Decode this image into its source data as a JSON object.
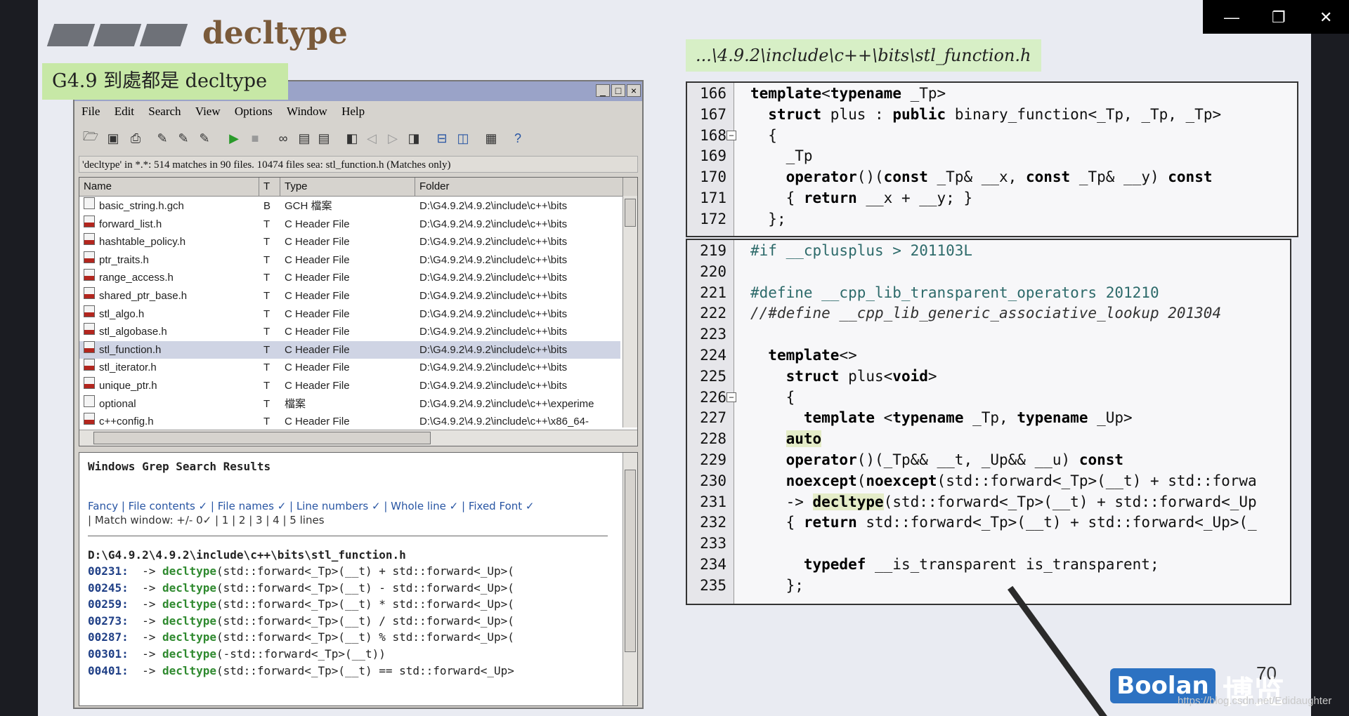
{
  "slide": {
    "title": "decltype",
    "green_label": "G4.9 到處都是 decltype",
    "path_label": "...\\4.9.2\\include\\c++\\bits\\stl_function.h",
    "page_number": "70"
  },
  "grep_window": {
    "menu": [
      "File",
      "Edit",
      "Search",
      "View",
      "Options",
      "Window",
      "Help"
    ],
    "status": "'decltype' in *.*: 514 matches in 90 files. 10474 files sea: stl_function.h (Matches only)",
    "columns": [
      "Name",
      "T",
      "Type",
      "Folder"
    ],
    "files": [
      {
        "name": "basic_string.h.gch",
        "t": "B",
        "type": "GCH 檔案",
        "folder": "D:\\G4.9.2\\4.9.2\\include\\c++\\bits"
      },
      {
        "name": "forward_list.h",
        "t": "T",
        "type": "C Header File",
        "folder": "D:\\G4.9.2\\4.9.2\\include\\c++\\bits"
      },
      {
        "name": "hashtable_policy.h",
        "t": "T",
        "type": "C Header File",
        "folder": "D:\\G4.9.2\\4.9.2\\include\\c++\\bits"
      },
      {
        "name": "ptr_traits.h",
        "t": "T",
        "type": "C Header File",
        "folder": "D:\\G4.9.2\\4.9.2\\include\\c++\\bits"
      },
      {
        "name": "range_access.h",
        "t": "T",
        "type": "C Header File",
        "folder": "D:\\G4.9.2\\4.9.2\\include\\c++\\bits"
      },
      {
        "name": "shared_ptr_base.h",
        "t": "T",
        "type": "C Header File",
        "folder": "D:\\G4.9.2\\4.9.2\\include\\c++\\bits"
      },
      {
        "name": "stl_algo.h",
        "t": "T",
        "type": "C Header File",
        "folder": "D:\\G4.9.2\\4.9.2\\include\\c++\\bits"
      },
      {
        "name": "stl_algobase.h",
        "t": "T",
        "type": "C Header File",
        "folder": "D:\\G4.9.2\\4.9.2\\include\\c++\\bits"
      },
      {
        "name": "stl_function.h",
        "t": "T",
        "type": "C Header File",
        "folder": "D:\\G4.9.2\\4.9.2\\include\\c++\\bits"
      },
      {
        "name": "stl_iterator.h",
        "t": "T",
        "type": "C Header File",
        "folder": "D:\\G4.9.2\\4.9.2\\include\\c++\\bits"
      },
      {
        "name": "unique_ptr.h",
        "t": "T",
        "type": "C Header File",
        "folder": "D:\\G4.9.2\\4.9.2\\include\\c++\\bits"
      },
      {
        "name": "optional",
        "t": "T",
        "type": "檔案",
        "folder": "D:\\G4.9.2\\4.9.2\\include\\c++\\experime"
      },
      {
        "name": "c++config.h",
        "t": "T",
        "type": "C Header File",
        "folder": "D:\\G4.9.2\\4.9.2\\include\\c++\\x86_64-"
      }
    ],
    "results_title": "Windows Grep Search Results",
    "results_links_1": "Fancy | File contents ✓ | File names ✓ | Line numbers ✓ | Whole line ✓ | Fixed Font ✓",
    "results_links_2": "| Match window: +/- 0✓ | 1 | 2 | 3 | 4 | 5 lines",
    "results_file": "D:\\G4.9.2\\4.9.2\\include\\c++\\bits\\stl_function.h",
    "results": [
      {
        "num": "00231:",
        "pre": "  -> ",
        "kw": "decltype",
        "rest": "(std::forward<_Tp>(__t) + std::forward<_Up>("
      },
      {
        "num": "00245:",
        "pre": "  -> ",
        "kw": "decltype",
        "rest": "(std::forward<_Tp>(__t) - std::forward<_Up>("
      },
      {
        "num": "00259:",
        "pre": "  -> ",
        "kw": "decltype",
        "rest": "(std::forward<_Tp>(__t) * std::forward<_Up>("
      },
      {
        "num": "00273:",
        "pre": "  -> ",
        "kw": "decltype",
        "rest": "(std::forward<_Tp>(__t) / std::forward<_Up>("
      },
      {
        "num": "00287:",
        "pre": "  -> ",
        "kw": "decltype",
        "rest": "(std::forward<_Tp>(__t) % std::forward<_Up>("
      },
      {
        "num": "00301:",
        "pre": "  -> ",
        "kw": "decltype",
        "rest": "(-std::forward<_Tp>(__t))"
      },
      {
        "num": "00401:",
        "pre": "  -> ",
        "kw": "decltype",
        "rest": "(std::forward<_Tp>(__t) == std::forward<_Up>"
      }
    ]
  },
  "code_top": [
    {
      "ln": "166",
      "indent": "",
      "parts": [
        [
          "kwb",
          "template"
        ],
        [
          "",
          "<"
        ],
        [
          "kwb",
          "typename"
        ],
        [
          "",
          " _Tp>"
        ]
      ]
    },
    {
      "ln": "167",
      "indent": "  ",
      "parts": [
        [
          "kwb",
          "struct"
        ],
        [
          "",
          " plus : "
        ],
        [
          "kwb",
          "public"
        ],
        [
          "",
          " binary_function<_Tp, _Tp, _Tp>"
        ]
      ]
    },
    {
      "ln": "168",
      "indent": "  ",
      "parts": [
        [
          "",
          "{"
        ]
      ]
    },
    {
      "ln": "169",
      "indent": "    ",
      "parts": [
        [
          "",
          "_Tp"
        ]
      ]
    },
    {
      "ln": "170",
      "indent": "    ",
      "parts": [
        [
          "kwb",
          "operator"
        ],
        [
          "",
          "()("
        ],
        [
          "kwb",
          "const"
        ],
        [
          "",
          " _Tp& __x, "
        ],
        [
          "kwb",
          "const"
        ],
        [
          "",
          " _Tp& __y) "
        ],
        [
          "kwb",
          "const"
        ]
      ]
    },
    {
      "ln": "171",
      "indent": "    ",
      "parts": [
        [
          "",
          "{ "
        ],
        [
          "kwb",
          "return"
        ],
        [
          "",
          " __x + __y; }"
        ]
      ]
    },
    {
      "ln": "172",
      "indent": "  ",
      "parts": [
        [
          "",
          "};"
        ]
      ]
    }
  ],
  "code_bottom": [
    {
      "ln": "219",
      "indent": "",
      "parts": [
        [
          "pp",
          "#if __cplusplus > 201103L"
        ]
      ]
    },
    {
      "ln": "220",
      "indent": "",
      "parts": []
    },
    {
      "ln": "221",
      "indent": "",
      "parts": [
        [
          "pp",
          "#define __cpp_lib_transparent_operators 201210"
        ]
      ]
    },
    {
      "ln": "222",
      "indent": "",
      "parts": [
        [
          "cm",
          "//#define __cpp_lib_generic_associative_lookup 201304"
        ]
      ]
    },
    {
      "ln": "223",
      "indent": "",
      "parts": []
    },
    {
      "ln": "224",
      "indent": "  ",
      "parts": [
        [
          "kwb",
          "template"
        ],
        [
          "",
          "<>"
        ]
      ]
    },
    {
      "ln": "225",
      "indent": "    ",
      "parts": [
        [
          "kwb",
          "struct"
        ],
        [
          "",
          " plus<"
        ],
        [
          "kwb",
          "void"
        ],
        [
          "",
          ">"
        ]
      ]
    },
    {
      "ln": "226",
      "indent": "    ",
      "parts": [
        [
          "",
          "{"
        ]
      ]
    },
    {
      "ln": "227",
      "indent": "      ",
      "parts": [
        [
          "kwb",
          "template"
        ],
        [
          "",
          " <"
        ],
        [
          "kwb",
          "typename"
        ],
        [
          "",
          " _Tp, "
        ],
        [
          "kwb",
          "typename"
        ],
        [
          "",
          " _Up>"
        ]
      ]
    },
    {
      "ln": "228",
      "indent": "    ",
      "parts": [
        [
          "kwb hl",
          "auto"
        ]
      ]
    },
    {
      "ln": "229",
      "indent": "    ",
      "parts": [
        [
          "kwb",
          "operator"
        ],
        [
          "",
          "()(_Tp&& __t, _Up&& __u) "
        ],
        [
          "kwb",
          "const"
        ]
      ]
    },
    {
      "ln": "230",
      "indent": "    ",
      "parts": [
        [
          "kwb",
          "noexcept"
        ],
        [
          "",
          "("
        ],
        [
          "kwb",
          "noexcept"
        ],
        [
          "",
          "(std::forward<_Tp>(__t) + std::forwa"
        ]
      ]
    },
    {
      "ln": "231",
      "indent": "    ",
      "parts": [
        [
          "",
          "-> "
        ],
        [
          "kwb hl",
          "decltype"
        ],
        [
          "",
          "(std::forward<_Tp>(__t) + std::forward<_Up"
        ]
      ]
    },
    {
      "ln": "232",
      "indent": "    ",
      "parts": [
        [
          "",
          "{ "
        ],
        [
          "kwb",
          "return"
        ],
        [
          "",
          " std::forward<_Tp>(__t) + std::forward<_Up>(_"
        ]
      ]
    },
    {
      "ln": "233",
      "indent": "",
      "parts": []
    },
    {
      "ln": "234",
      "indent": "      ",
      "parts": [
        [
          "kwb",
          "typedef"
        ],
        [
          "",
          " __is_transparent is_transparent;"
        ]
      ]
    },
    {
      "ln": "235",
      "indent": "    ",
      "parts": [
        [
          "",
          "};"
        ]
      ]
    }
  ],
  "branding": {
    "logo": "Boolan",
    "logo_cn": "博览",
    "watermark": "https://blog.csdn.net/Edidaughter"
  }
}
